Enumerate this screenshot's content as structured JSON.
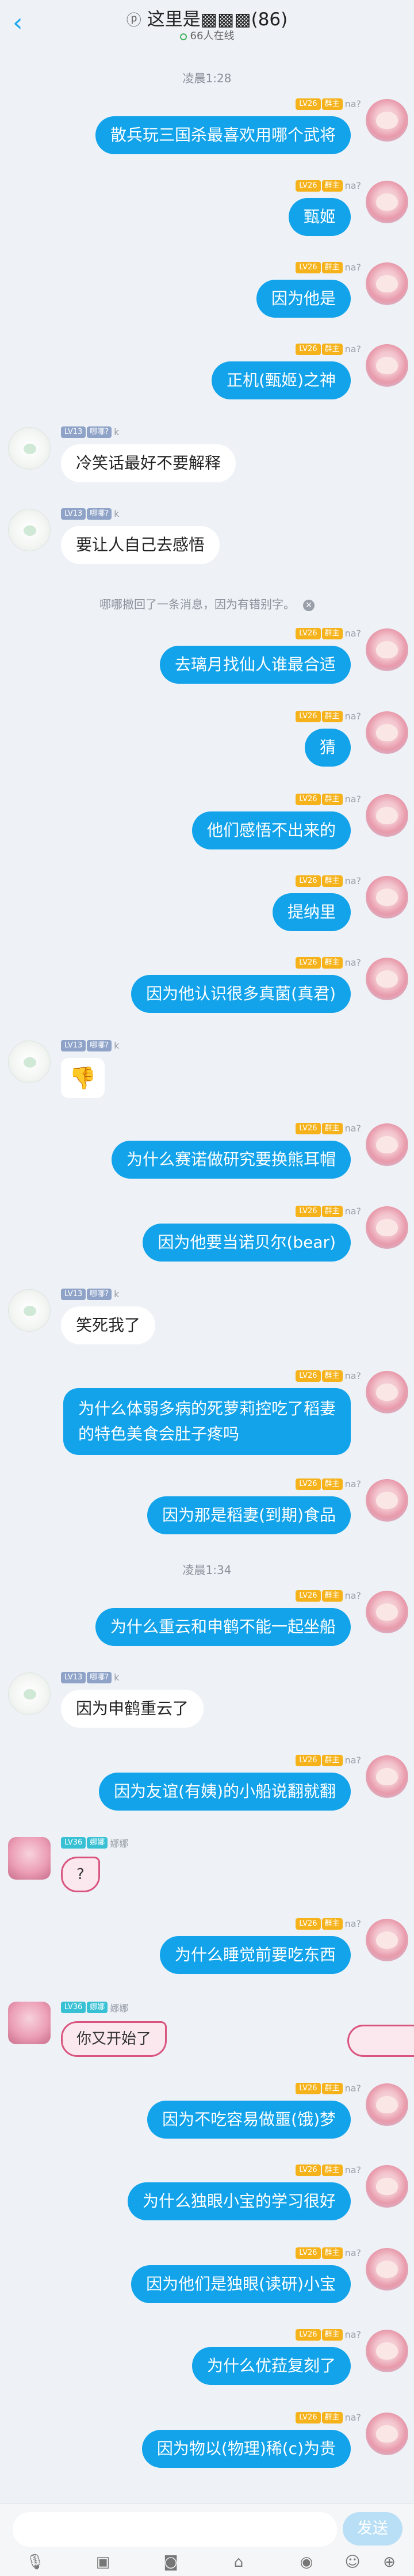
{
  "header": {
    "title": "这里是▩▩▩(86)",
    "online": "66人在线"
  },
  "system": {
    "time1": "凌晨1:28",
    "recall": "哪哪撤回了一条消息，因为有错别字。",
    "time2": "凌晨1:34"
  },
  "labels": {
    "lv26": "LV26",
    "lv13": "LV13",
    "lv36": "LV36",
    "owner": "群主",
    "role_yiyi": "哪哪?",
    "role_nana": "娜娜",
    "nick_na": "na?",
    "nick_k": "k",
    "nick_nana": "娜娜"
  },
  "messages": [
    {
      "text": "散兵玩三国杀最喜欢用哪个武将"
    },
    {
      "text": "甄姬"
    },
    {
      "text": "因为他是"
    },
    {
      "text": "正机(甄姬)之神"
    },
    {
      "text": "冷笑话最好不要解释"
    },
    {
      "text": "要让人自己去感悟"
    },
    {
      "text": "去璃月找仙人谁最合适"
    },
    {
      "text": "猜"
    },
    {
      "text": "他们感悟不出来的"
    },
    {
      "text": "提纳里"
    },
    {
      "text": "因为他认识很多真菌(真君)"
    },
    {
      "text": "👎"
    },
    {
      "text": "为什么赛诺做研究要换熊耳帽"
    },
    {
      "text": "因为他要当诺贝尔(bear)"
    },
    {
      "text": "笑死我了"
    },
    {
      "text": "为什么体弱多病的死萝莉控吃了稻妻的特色美食会肚子疼吗"
    },
    {
      "text": "因为那是稻妻(到期)食品"
    },
    {
      "text": "为什么重云和申鹤不能一起坐船"
    },
    {
      "text": "因为申鹤重云了"
    },
    {
      "text": "因为友谊(有姨)的小船说翻就翻"
    },
    {
      "text": "?"
    },
    {
      "text": "为什么睡觉前要吃东西"
    },
    {
      "text": "你又开始了"
    },
    {
      "text": "因为不吃容易做噩(饿)梦"
    },
    {
      "text": "为什么独眼小宝的学习很好"
    },
    {
      "text": "因为他们是独眼(读研)小宝"
    },
    {
      "text": "为什么优菈复刻了"
    },
    {
      "text": "因为物以(物理)稀(c)为贵"
    }
  ],
  "composer": {
    "placeholder": "",
    "send": "发送"
  },
  "toolbar_icons": [
    "mic-icon",
    "image-icon",
    "camera-icon",
    "gift-icon",
    "emoji-face-icon",
    "emoji-smile-icon",
    "plus-icon"
  ],
  "colors": {
    "accent": "#12a3ea",
    "owner_badge": "#f6b21b",
    "pink_bubble_border": "#d9557f"
  }
}
